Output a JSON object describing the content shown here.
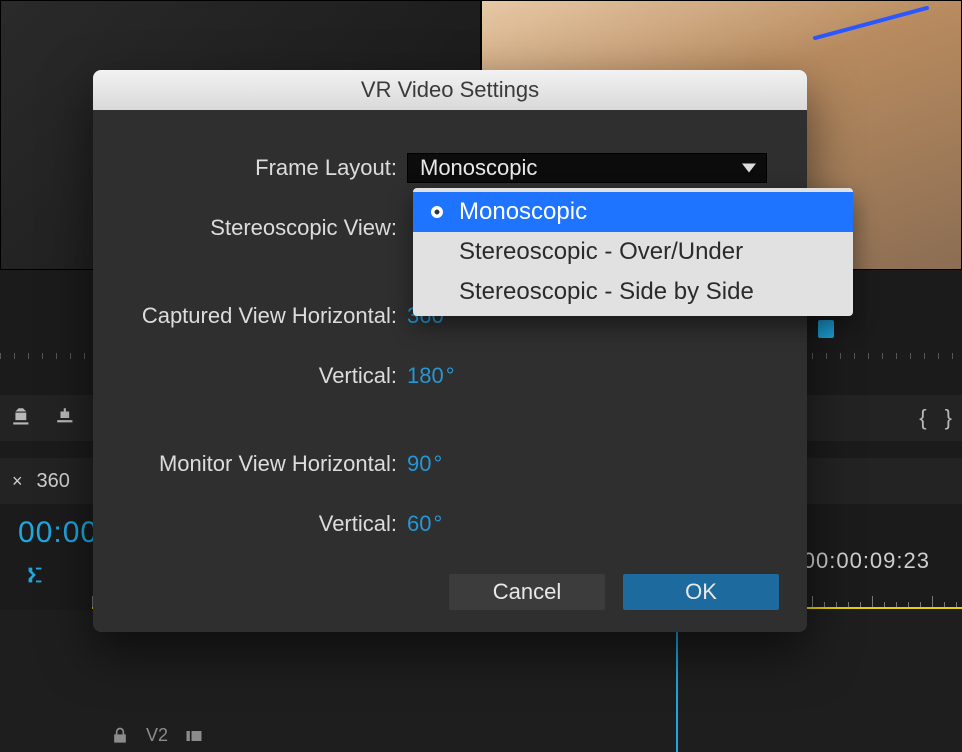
{
  "dialog": {
    "title": "VR Video Settings",
    "fields": {
      "frame_layout": {
        "label": "Frame Layout:",
        "value": "Monoscopic"
      },
      "stereoscopic_view": {
        "label": "Stereoscopic View:"
      },
      "captured_horizontal": {
        "label": "Captured View Horizontal:",
        "value": "360",
        "unit": "°"
      },
      "captured_vertical": {
        "label": "Vertical:",
        "value": "180",
        "unit": "°"
      },
      "monitor_horizontal": {
        "label": "Monitor View Horizontal:",
        "value": "90",
        "unit": "°"
      },
      "monitor_vertical": {
        "label": "Vertical:",
        "value": "60",
        "unit": "°"
      }
    },
    "frame_layout_options": [
      {
        "label": "Monoscopic",
        "selected": true
      },
      {
        "label": "Stereoscopic - Over/Under",
        "selected": false
      },
      {
        "label": "Stereoscopic - Side by Side",
        "selected": false
      }
    ],
    "buttons": {
      "cancel": "Cancel",
      "ok": "OK"
    }
  },
  "editor": {
    "sequence_tab": {
      "name": "360",
      "close_glyph": "×"
    },
    "timecode_current": "00:00",
    "timecode_ruler": "00:00:09:23",
    "track_label": "V2",
    "toolbar_braces": {
      "left": "{",
      "right": "}"
    }
  }
}
